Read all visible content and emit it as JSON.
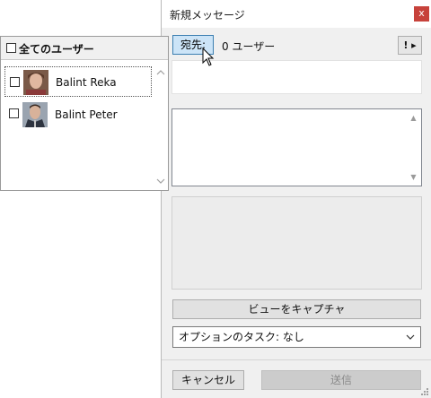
{
  "window": {
    "title": "新規メッセージ",
    "close_glyph": "x"
  },
  "recipients": {
    "to_label": "宛先:",
    "count_text": "0 ユーザー",
    "priority_glyph": "! ▸"
  },
  "actions": {
    "capture_label": "ビューをキャプチャ",
    "task_select_value": "オプションのタスク: なし",
    "cancel_label": "キャンセル",
    "send_label": "送信"
  },
  "user_picker": {
    "select_all_label": "全てのユーザー",
    "users": [
      {
        "name": "Balint Reka"
      },
      {
        "name": "Balint Peter"
      }
    ]
  },
  "colors": {
    "close_button": "#c7423b",
    "to_button_bg": "#cce4f7",
    "to_button_border": "#3c7fb1"
  }
}
